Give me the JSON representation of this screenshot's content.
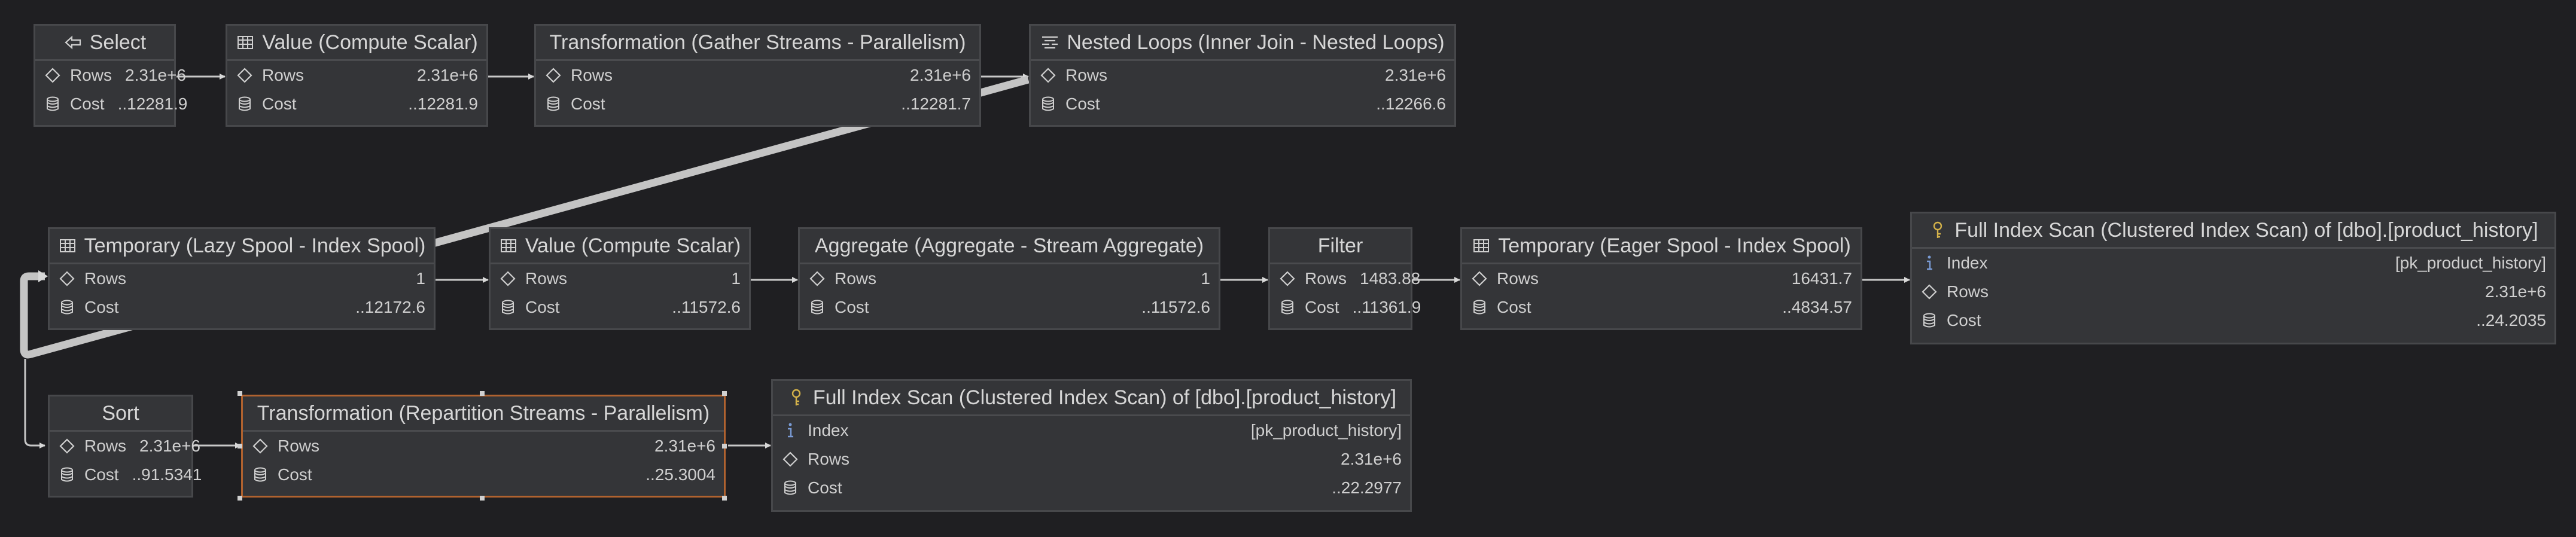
{
  "nodes": [
    {
      "id": "select",
      "title": "Select",
      "icon": "arrow-left-icon",
      "rows": [
        {
          "icon": "rows-icon",
          "label": "Rows",
          "value": "2.31e+6"
        },
        {
          "icon": "cost-icon",
          "label": "Cost",
          "value": "..12281.9"
        }
      ]
    },
    {
      "id": "value1",
      "title": "Value (Compute Scalar)",
      "icon": "table-icon",
      "rows": [
        {
          "icon": "rows-icon",
          "label": "Rows",
          "value": "2.31e+6"
        },
        {
          "icon": "cost-icon",
          "label": "Cost",
          "value": "..12281.9"
        }
      ]
    },
    {
      "id": "gather",
      "title": "Transformation (Gather Streams - Parallelism)",
      "icon": "",
      "rows": [
        {
          "icon": "rows-icon",
          "label": "Rows",
          "value": "2.31e+6"
        },
        {
          "icon": "cost-icon",
          "label": "Cost",
          "value": "..12281.7"
        }
      ]
    },
    {
      "id": "nested",
      "title": "Nested Loops (Inner Join - Nested Loops)",
      "icon": "nested-loops-icon",
      "rows": [
        {
          "icon": "rows-icon",
          "label": "Rows",
          "value": "2.31e+6"
        },
        {
          "icon": "cost-icon",
          "label": "Cost",
          "value": "..12266.6"
        }
      ]
    },
    {
      "id": "lazyspool",
      "title": "Temporary (Lazy Spool - Index Spool)",
      "icon": "table-icon",
      "rows": [
        {
          "icon": "rows-icon",
          "label": "Rows",
          "value": "1"
        },
        {
          "icon": "cost-icon",
          "label": "Cost",
          "value": "..12172.6"
        }
      ]
    },
    {
      "id": "value2",
      "title": "Value (Compute Scalar)",
      "icon": "table-icon",
      "rows": [
        {
          "icon": "rows-icon",
          "label": "Rows",
          "value": "1"
        },
        {
          "icon": "cost-icon",
          "label": "Cost",
          "value": "..11572.6"
        }
      ]
    },
    {
      "id": "aggregate",
      "title": "Aggregate (Aggregate - Stream Aggregate)",
      "icon": "",
      "rows": [
        {
          "icon": "rows-icon",
          "label": "Rows",
          "value": "1"
        },
        {
          "icon": "cost-icon",
          "label": "Cost",
          "value": "..11572.6"
        }
      ]
    },
    {
      "id": "filter",
      "title": "Filter",
      "icon": "",
      "rows": [
        {
          "icon": "rows-icon",
          "label": "Rows",
          "value": "1483.88"
        },
        {
          "icon": "cost-icon",
          "label": "Cost",
          "value": "..11361.9"
        }
      ]
    },
    {
      "id": "eagerspool",
      "title": "Temporary (Eager Spool - Index Spool)",
      "icon": "table-icon",
      "rows": [
        {
          "icon": "rows-icon",
          "label": "Rows",
          "value": "16431.7"
        },
        {
          "icon": "cost-icon",
          "label": "Cost",
          "value": "..4834.57"
        }
      ]
    },
    {
      "id": "scan1",
      "title": "Full Index Scan (Clustered Index Scan) of [dbo].[product_history]",
      "icon": "key-icon",
      "rows": [
        {
          "icon": "info-icon",
          "label": "Index",
          "value": "[pk_product_history]"
        },
        {
          "icon": "rows-icon",
          "label": "Rows",
          "value": "2.31e+6"
        },
        {
          "icon": "cost-icon",
          "label": "Cost",
          "value": "..24.2035"
        }
      ]
    },
    {
      "id": "sort",
      "title": "Sort",
      "icon": "",
      "rows": [
        {
          "icon": "rows-icon",
          "label": "Rows",
          "value": "2.31e+6"
        },
        {
          "icon": "cost-icon",
          "label": "Cost",
          "value": "..91.5341"
        }
      ]
    },
    {
      "id": "repartition",
      "title": "Transformation (Repartition Streams - Parallelism)",
      "icon": "",
      "rows": [
        {
          "icon": "rows-icon",
          "label": "Rows",
          "value": "2.31e+6"
        },
        {
          "icon": "cost-icon",
          "label": "Cost",
          "value": "..25.3004"
        }
      ]
    },
    {
      "id": "scan2",
      "title": "Full Index Scan (Clustered Index Scan) of [dbo].[product_history]",
      "icon": "key-icon",
      "rows": [
        {
          "icon": "info-icon",
          "label": "Index",
          "value": "[pk_product_history]"
        },
        {
          "icon": "rows-icon",
          "label": "Rows",
          "value": "2.31e+6"
        },
        {
          "icon": "cost-icon",
          "label": "Cost",
          "value": "..22.2977"
        }
      ]
    }
  ],
  "colors": {
    "background": "#1f1f22",
    "node_bg": "#343538",
    "node_border": "#47484b",
    "selected_border": "#b0622f",
    "wire": "#c8c8c8",
    "key_icon": "#d4b24a",
    "info_icon": "#7a9cd6"
  }
}
